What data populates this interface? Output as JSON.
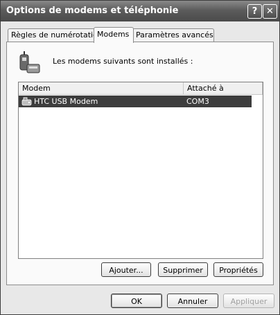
{
  "window": {
    "title": "Options de modems et téléphonie",
    "help_label": "?",
    "close_label": "✕"
  },
  "tabs": [
    {
      "label": "Règles de numérotation",
      "active": false
    },
    {
      "label": "Modems",
      "active": true
    },
    {
      "label": "Paramètres avancés",
      "active": false
    }
  ],
  "modems": {
    "intro_text": "Les modems suivants sont installés :",
    "columns": [
      "Modem",
      "Attaché à"
    ],
    "rows": [
      {
        "name": "HTC USB Modem",
        "port": "COM3",
        "selected": true
      }
    ],
    "icon": "modem-icon"
  },
  "panel_buttons": {
    "add": "Ajouter...",
    "remove": "Supprimer",
    "properties": "Propriétés"
  },
  "dialog_buttons": {
    "ok": "OK",
    "cancel": "Annuler",
    "apply": "Appliquer"
  }
}
